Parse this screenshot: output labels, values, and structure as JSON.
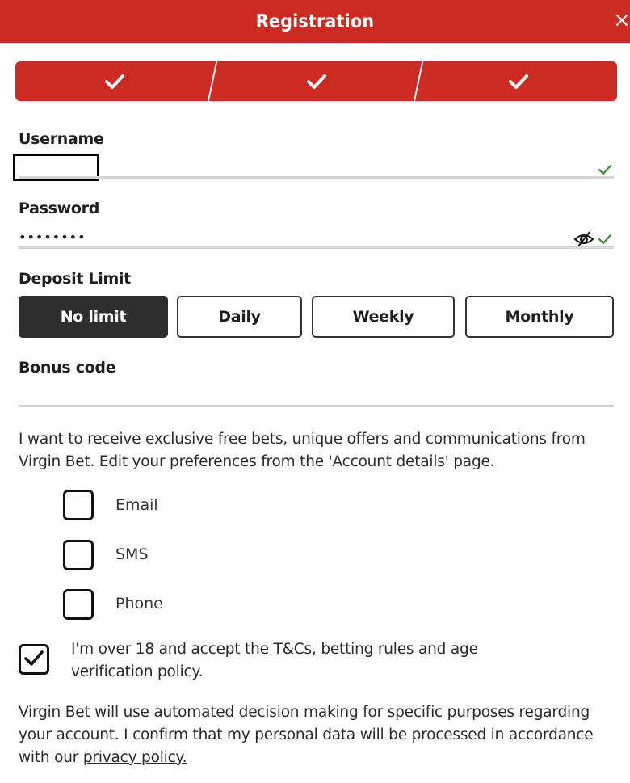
{
  "header": {
    "title": "Registration",
    "close_icon": "×"
  },
  "stepper": {
    "steps": [
      {
        "status": "complete",
        "icon": "checkmark-icon"
      },
      {
        "status": "complete",
        "icon": "checkmark-icon"
      },
      {
        "status": "complete",
        "icon": "checkmark-icon"
      }
    ]
  },
  "form": {
    "username": {
      "label": "Username",
      "value": "[redacted]",
      "valid": true
    },
    "password": {
      "label": "Password",
      "value_masked": "••••••••",
      "valid": true,
      "visibility_icon": "eye-slash-icon"
    },
    "deposit_limit": {
      "label": "Deposit Limit",
      "options": [
        "No limit",
        "Daily",
        "Weekly",
        "Monthly"
      ],
      "selected": "No limit"
    },
    "bonus_code": {
      "label": "Bonus code",
      "value": ""
    }
  },
  "marketing": {
    "text": "I want to receive exclusive free bets, unique offers and communications from Virgin Bet. Edit your preferences from the 'Account details' page.",
    "channels": [
      {
        "label": "Email",
        "checked": false
      },
      {
        "label": "SMS",
        "checked": false
      },
      {
        "label": "Phone",
        "checked": false
      }
    ]
  },
  "terms": {
    "checked": true,
    "text_before": "I'm over 18 and accept the ",
    "link_tcs": "T&Cs",
    "sep": ", ",
    "link_betting_rules": "betting rules",
    "text_after": " and age verification policy."
  },
  "privacy": {
    "text": "Virgin Bet will use automated decision making for specific purposes regarding your account. I confirm that my personal data will be processed in accordance with our ",
    "link": "privacy policy."
  },
  "colors": {
    "brand_red": "#cc2b22",
    "selected_dark": "#2d2d2d",
    "valid_green": "#3a8a2e"
  }
}
